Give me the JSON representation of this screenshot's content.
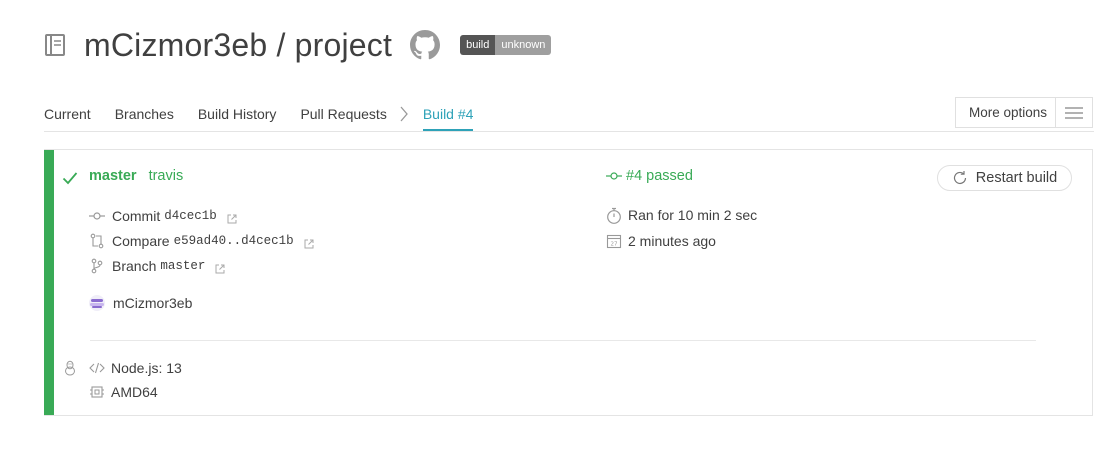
{
  "header": {
    "repo_title": "mCizmor3eb / project",
    "badge_left": "build",
    "badge_right": "unknown"
  },
  "tabs": [
    {
      "label": "Current"
    },
    {
      "label": "Branches"
    },
    {
      "label": "Build History"
    },
    {
      "label": "Pull Requests"
    },
    {
      "label": "Build #4",
      "active": true
    }
  ],
  "more_options": {
    "label": "More options"
  },
  "build": {
    "status": "passed",
    "branch": "master",
    "message": "travis",
    "number_label": "#4 passed",
    "commit_label": "Commit",
    "commit_sha": "d4cec1b",
    "compare_label": "Compare",
    "compare_range": "e59ad40..d4cec1b",
    "branch_label": "Branch",
    "branch_value": "master",
    "author": "mCizmor3eb",
    "duration": "Ran for 10 min 2 sec",
    "finished": "2 minutes ago",
    "restart_label": "Restart build",
    "language": "Node.js: 13",
    "arch": "AMD64"
  },
  "colors": {
    "passed_green": "#39aa56",
    "active_tab": "#2ea2b8",
    "badge_left": "#555555",
    "badge_right": "#9f9f9f"
  },
  "icons": [
    "repo-book-icon",
    "github-icon",
    "check-icon",
    "commit-icon",
    "compare-icon",
    "branch-icon",
    "external-link-icon",
    "stopwatch-icon",
    "calendar-icon",
    "restart-icon",
    "linux-icon",
    "code-icon",
    "cpu-icon",
    "hamburger-icon",
    "chevron-right-icon"
  ]
}
